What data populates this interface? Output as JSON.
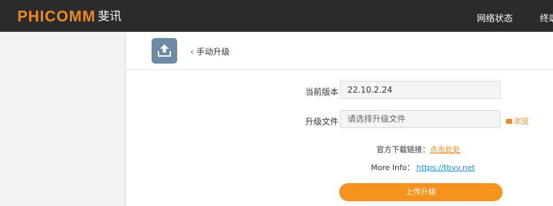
{
  "header": {
    "brand_en": "PHICOMM",
    "brand_cn": "斐讯",
    "nav": [
      "网络状态",
      "终端"
    ]
  },
  "page": {
    "icon": "upload-icon",
    "back_label": "手动升级"
  },
  "form": {
    "version_label": "当前版本",
    "version_value": "22.10.2.24",
    "file_label": "升级文件",
    "file_placeholder": "请选择升级文件",
    "browse_label": "浏览",
    "download_prefix": "官方下载链接：",
    "download_link": "点击此处",
    "info_prefix": "More Info：",
    "info_link": "https://tbvv.net",
    "upload_button": "上传升级"
  },
  "colors": {
    "topbar": "#2b2b2b",
    "brand_orange": "#f08a1c",
    "button": "#f5931e",
    "link_blue": "#1a8fd6",
    "icon_tile": "#6f8aa6"
  }
}
